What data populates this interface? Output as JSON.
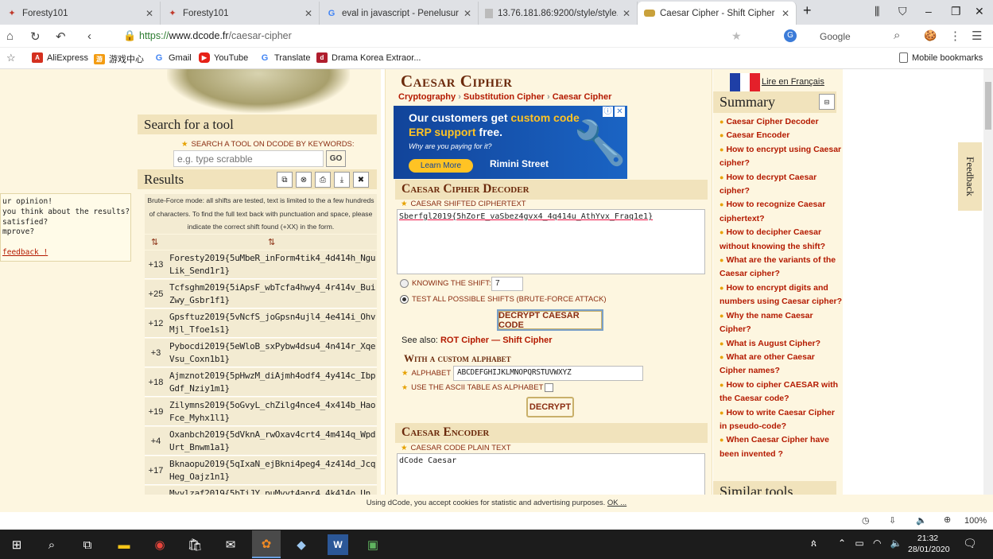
{
  "browser": {
    "tabs": [
      {
        "title": "Foresty101",
        "icon": "#c0392b"
      },
      {
        "title": "Foresty101",
        "icon": "#c0392b"
      },
      {
        "title": "eval in javascript - Penelusuran",
        "icon": "#4285f4"
      },
      {
        "title": "13.76.181.86:9200/style/style.c",
        "icon": "#888888"
      },
      {
        "title": "Caesar Cipher - Shift Cipher -",
        "icon": "#c9a13b"
      }
    ],
    "url_prefix": "https://",
    "url_domain": "www.dcode.fr",
    "url_path": "/caesar-cipher",
    "search_engine": "Google",
    "bookmarks": [
      "AliExpress",
      "游戏中心",
      "Gmail",
      "YouTube",
      "Translate",
      "Drama Korea Extraor..."
    ],
    "mobile_bookmarks": "Mobile bookmarks"
  },
  "left": {
    "search_title": "Search for a tool",
    "search_label": "SEARCH A TOOL ON DCODE BY KEYWORDS:",
    "search_placeholder": "e.g. type scrabble",
    "go": "GO",
    "results_title": "Results",
    "bruteforce_note": "Brute-Force mode: all shifts are tested, text is limited to the a few hundreds of characters. To find the full text back with punctuation and space, please indicate the correct shift found (+XX) in the form.",
    "col1": "⇅",
    "col2": "⇅",
    "results": [
      {
        "shift": "+13",
        "text": "Foresty2019{5uMbeR_inForm4tik4_4d414h_NguLik_Send1r1}"
      },
      {
        "shift": "+25",
        "text": "Tcfsghm2019{5iApsF_wbTcfa4hwy4_4r414v_BuiZwy_Gsbr1f1}"
      },
      {
        "shift": "+12",
        "text": "Gpsftuz2019{5vNcfS_joGpsn4ujl4_4e414i_OhvMjl_Tfoe1s1}"
      },
      {
        "shift": "+3",
        "text": "Pybocdi2019{5eWloB_sxPybw4dsu4_4n414r_XqeVsu_Coxn1b1}"
      },
      {
        "shift": "+18",
        "text": "Ajmznot2019{5pHwzM_diAjmh4odf4_4y414c_IbpGdf_Nziy1m1}"
      },
      {
        "shift": "+19",
        "text": "Zilymns2019{5oGvyL_chZilg4nce4_4x414b_HaoFce_Myhx1l1}"
      },
      {
        "shift": "+4",
        "text": "Oxanbch2019{5dVknA_rwOxav4crt4_4m414q_WpdUrt_Bnwm1a1}"
      },
      {
        "shift": "+17",
        "text": "Bknaopu2019{5qIxaN_ejBkni4peg4_4z414d_JcqHeg_Oajz1n1}"
      },
      {
        "shift": "",
        "text": "Mvylzaf2019{5bTiJY_puMvyt4apr4_4k414o_Un"
      }
    ],
    "feedback_lines": [
      "ur opinion!",
      "you think about the results?",
      "satisfied?",
      "mprove?"
    ],
    "feedback_link": "feedback !"
  },
  "center": {
    "title": "Caesar Cipher",
    "breadcrumb": [
      "Cryptography",
      "Substitution Cipher",
      "Caesar Cipher"
    ],
    "ad_line1a": "Our customers get ",
    "ad_line1b": "custom code",
    "ad_line2a": "ERP support",
    "ad_line2b": " free.",
    "ad_line3": "Why are you paying for it?",
    "ad_btn": "Learn More",
    "ad_brand": "Rimini Street",
    "decoder_title": "Caesar Cipher Decoder",
    "ciphertext_label": "CAESAR SHIFTED CIPHERTEXT",
    "ciphertext": "Sberfgl2019{5hZorE_vaSbez4gvx4_4q414u_AthYvx_Fraq1e1}",
    "known_shift_label": "KNOWING THE SHIFT:",
    "known_shift_value": "7",
    "bruteforce_label": "TEST ALL POSSIBLE SHIFTS (BRUTE-FORCE ATTACK)",
    "decrypt_btn": "DECRYPT CAESAR CODE",
    "see_also": "See also:",
    "see_also_link1": "ROT Cipher",
    "see_also_sep": " — ",
    "see_also_link2": "Shift Cipher",
    "custom_title": "With a custom alphabet",
    "alphabet_label": "ALPHABET",
    "alphabet_value": "ABCDEFGHIJKLMNOPQRSTUVWXYZ",
    "ascii_label": "USE THE ASCII TABLE AS ALPHABET",
    "decrypt2_btn": "DECRYPT",
    "encoder_title": "Caesar Encoder",
    "plaintext_label": "CAESAR CODE PLAIN TEXT",
    "plaintext": "dCode Caesar"
  },
  "right": {
    "french": "Lire en Français",
    "summary_title": "Summary",
    "summary_items": [
      "Caesar Cipher Decoder",
      "Caesar Encoder",
      "How to encrypt using Caesar cipher?",
      "How to decrypt Caesar cipher?",
      "How to recognize Caesar ciphertext?",
      "How to decipher Caesar without knowing the shift?",
      "What are the variants of the Caesar cipher?",
      "How to encrypt digits and numbers using Caesar cipher?",
      "Why the name Caesar Cipher?",
      "What is August Cipher?",
      "What are other Caesar Cipher names?",
      "How to cipher CAESAR with the Caesar code?",
      "How to write Caesar Cipher in pseudo-code?",
      "When Caesar Cipher have been invented ?"
    ],
    "similar_tools": "Similar tools",
    "feedback_tab": "Feedback"
  },
  "cookie": {
    "text": "Using dCode, you accept cookies for statistic and advertising purposes.",
    "ok": "OK ..."
  },
  "status": {
    "zoom": "100%"
  },
  "taskbar": {
    "time": "21:32",
    "date": "28/01/2020"
  },
  "colors": {
    "accent": "#b41a00",
    "panel": "#fdf6e0",
    "header": "#f1e3bc",
    "ad_blue": "#1a56a8"
  }
}
